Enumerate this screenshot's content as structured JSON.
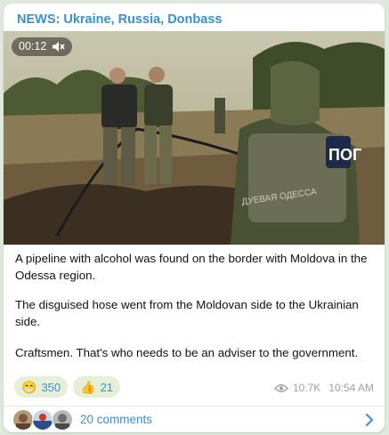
{
  "post": {
    "channel_name": "NEWS: Ukraine, Russia, Donbass",
    "video": {
      "duration": "00:12",
      "watermark": "ДУЕВАЯ ОДЕССА",
      "vest_patch": "ПОГ"
    },
    "caption_lines": [
      "A pipeline with alcohol was found on the border with Moldova in the Odessa region.",
      "The disguised hose went from the Moldovan side to the Ukrainian side.",
      "Craftsmen. That's who needs to be an adviser to the government."
    ],
    "reactions": [
      {
        "emoji": "😁",
        "count": "350"
      },
      {
        "emoji": "👍",
        "count": "21"
      }
    ],
    "views": "10.7K",
    "time": "10:54 AM",
    "comments_label": "20 comments"
  },
  "colors": {
    "accent": "#3a8fd0",
    "reaction_bg": "#e6f0d8",
    "page_bg": "#dfe9dd"
  }
}
